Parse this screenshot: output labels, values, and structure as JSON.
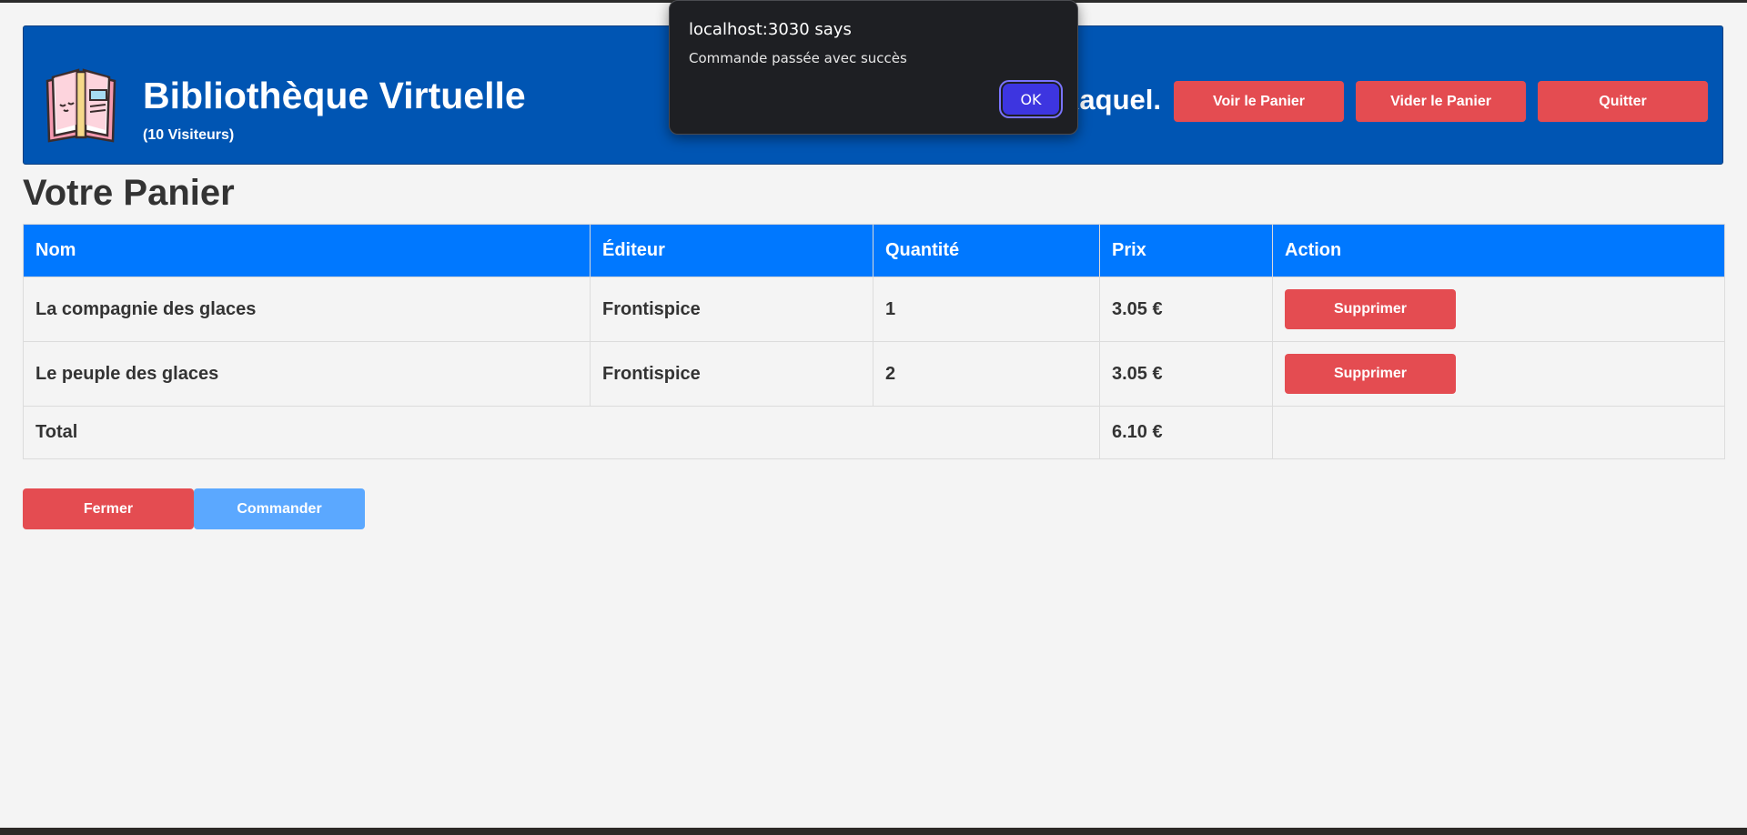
{
  "header": {
    "title": "Bibliothèque Virtuelle",
    "visitors": "(10 Visiteurs)",
    "greeting": "Raquel.",
    "buttons": {
      "view_cart": "Voir le Panier",
      "empty_cart": "Vider le Panier",
      "quit": "Quitter"
    }
  },
  "page_title": "Votre Panier",
  "table": {
    "columns": [
      "Nom",
      "Éditeur",
      "Quantité",
      "Prix",
      "Action"
    ],
    "rows": [
      {
        "name": "La compagnie des glaces",
        "publisher": "Frontispice",
        "quantity": "1",
        "price": "3.05 €",
        "action": "Supprimer"
      },
      {
        "name": "Le peuple des glaces",
        "publisher": "Frontispice",
        "quantity": "2",
        "price": "3.05 €",
        "action": "Supprimer"
      }
    ],
    "total_label": "Total",
    "total_value": "6.10 €"
  },
  "footer_buttons": {
    "close": "Fermer",
    "order": "Commander"
  },
  "dialog": {
    "title": "localhost:3030 says",
    "message": "Commande passée avec succès",
    "ok": "OK"
  },
  "colors": {
    "header_bg": "#0055b3",
    "table_header_bg": "#0078ff",
    "danger": "#e44c51",
    "order_button": "#5ba8ff",
    "dialog_bg": "#1e1f23",
    "dialog_ok": "#3d35e0"
  },
  "icons": {
    "logo": "open-book-icon"
  }
}
